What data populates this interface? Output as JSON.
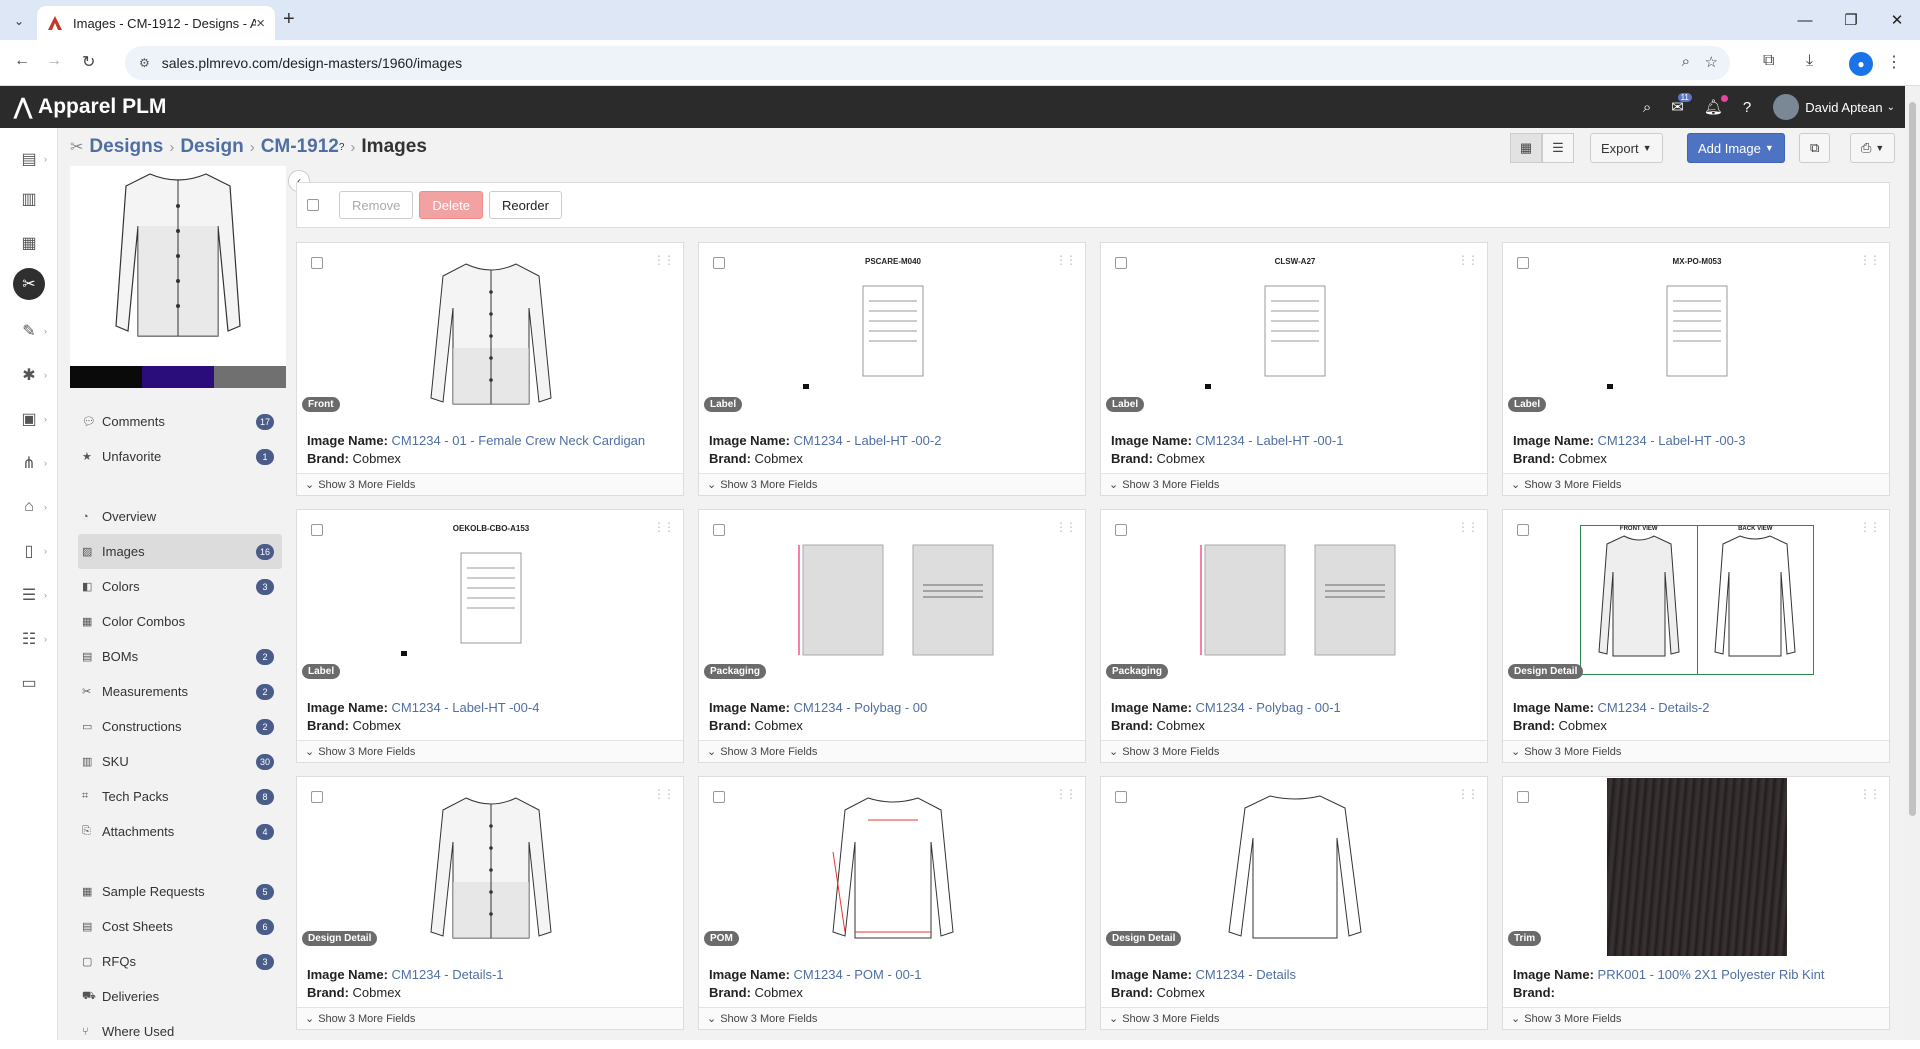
{
  "browser": {
    "tab_title": "Images - CM-1912 - Designs - A",
    "url_site_icon": "site-info-icon",
    "url": "sales.plmrevo.com/design-masters/1960/images"
  },
  "app": {
    "name": "Apparel PLM",
    "user": "David Aptean",
    "messages_badge": "11"
  },
  "breadcrumb": {
    "designs": "Designs",
    "design": "Design",
    "code": "CM-1912",
    "help": "?",
    "current": "Images"
  },
  "toolbar": {
    "export": "Export",
    "add_image": "Add Image"
  },
  "actions": {
    "remove": "Remove",
    "delete": "Delete",
    "reorder": "Reorder"
  },
  "swatch_colors": [
    "#0a0a0a",
    "#2a0d7a",
    "#707070"
  ],
  "menu": [
    {
      "label": "Comments",
      "icon": "comment-icon",
      "badge": "17"
    },
    {
      "label": "Unfavorite",
      "icon": "star-icon",
      "badge": "1"
    },
    {
      "label": "Overview",
      "icon": "dashboard-icon",
      "badge": ""
    },
    {
      "label": "Images",
      "icon": "image-icon",
      "badge": "16"
    },
    {
      "label": "Colors",
      "icon": "palette-icon",
      "badge": "3"
    },
    {
      "label": "Color Combos",
      "icon": "grid-icon",
      "badge": ""
    },
    {
      "label": "BOMs",
      "icon": "table-icon",
      "badge": "2"
    },
    {
      "label": "Measurements",
      "icon": "ruler-icon",
      "badge": "2"
    },
    {
      "label": "Constructions",
      "icon": "file-icon",
      "badge": "2"
    },
    {
      "label": "SKU",
      "icon": "barcode-icon",
      "badge": "30"
    },
    {
      "label": "Tech Packs",
      "icon": "techpack-icon",
      "badge": "8"
    },
    {
      "label": "Attachments",
      "icon": "paperclip-icon",
      "badge": "4"
    },
    {
      "label": "Sample Requests",
      "icon": "sample-icon",
      "badge": "5"
    },
    {
      "label": "Cost Sheets",
      "icon": "calculator-icon",
      "badge": "6"
    },
    {
      "label": "RFQs",
      "icon": "rfq-icon",
      "badge": "3"
    },
    {
      "label": "Deliveries",
      "icon": "truck-icon",
      "badge": ""
    },
    {
      "label": "Where Used",
      "icon": "branch-icon",
      "badge": ""
    }
  ],
  "labels": {
    "image_name": "Image Name",
    "brand": "Brand",
    "more_fields": "Show 3 More Fields"
  },
  "cards": [
    {
      "tag": "Front",
      "name": "CM1234 - 01 - Female Crew Neck Cardigan",
      "brand": "Cobmex",
      "kind": "cardigan-front"
    },
    {
      "tag": "Label",
      "name": "CM1234 - Label-HT -00-2",
      "brand": "Cobmex",
      "kind": "label-doc",
      "doc_title": "PSCARE-M040"
    },
    {
      "tag": "Label",
      "name": "CM1234 - Label-HT -00-1",
      "brand": "Cobmex",
      "kind": "label-doc",
      "doc_title": "CLSW-A27"
    },
    {
      "tag": "Label",
      "name": "CM1234 - Label-HT -00-3",
      "brand": "Cobmex",
      "kind": "label-doc",
      "doc_title": "MX-PO-M053"
    },
    {
      "tag": "Label",
      "name": "CM1234 - Label-HT -00-4",
      "brand": "Cobmex",
      "kind": "label-doc",
      "doc_title": "OEKOLB-CBO-A153"
    },
    {
      "tag": "Packaging",
      "name": "CM1234 - Polybag - 00",
      "brand": "Cobmex",
      "kind": "polybag"
    },
    {
      "tag": "Packaging",
      "name": "CM1234 - Polybag - 00-1",
      "brand": "Cobmex",
      "kind": "polybag"
    },
    {
      "tag": "Design Detail",
      "name": "CM1234 - Details-2",
      "brand": "Cobmex",
      "kind": "front-back",
      "front": "FRONT VIEW",
      "back": "BACK VIEW"
    },
    {
      "tag": "Design Detail",
      "name": "CM1234 - Details-1",
      "brand": "Cobmex",
      "kind": "cardigan-front"
    },
    {
      "tag": "POM",
      "name": "CM1234 - POM - 00-1",
      "brand": "Cobmex",
      "kind": "pom"
    },
    {
      "tag": "Design Detail",
      "name": "CM1234 - Details",
      "brand": "Cobmex",
      "kind": "sweater-back"
    },
    {
      "tag": "Trim",
      "name": "PRK001 - 100% 2X1 Polyester Rib Kint",
      "brand": "",
      "kind": "fabric"
    }
  ]
}
